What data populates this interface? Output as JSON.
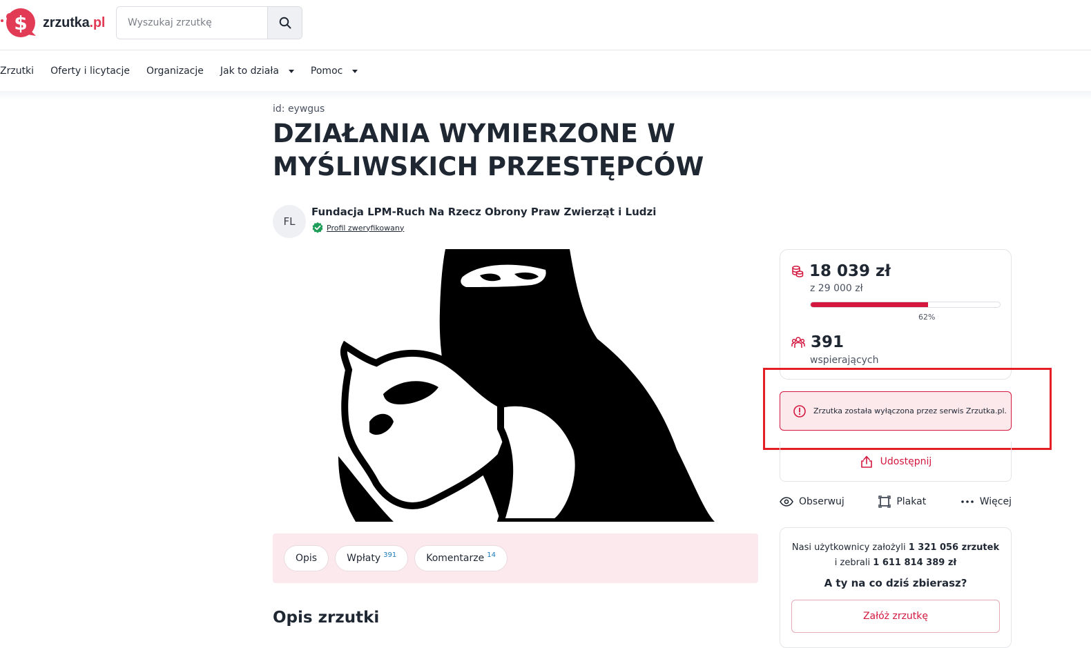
{
  "brand": {
    "name": "zrzutka",
    "tld": ".pl",
    "accent": "#e23b56"
  },
  "search": {
    "placeholder": "Wyszukaj zrzutkę",
    "icon": "search-icon"
  },
  "nav": {
    "items": [
      {
        "label": "Zrzutki"
      },
      {
        "label": "Oferty i licytacje"
      },
      {
        "label": "Organizacje"
      },
      {
        "label": "Jak to działa"
      },
      {
        "label": "Pomoc"
      }
    ]
  },
  "fundraiser": {
    "id_label": "id: eywgus",
    "title": "DZIAŁANIA WYMIERZONE W MYŚLIWSKICH PRZESTĘPCÓW",
    "organizer": {
      "initials": "FL",
      "name": "Fundacja LPM-Ruch Na Rzecz Obrony Praw Zwierząt i Ludzi",
      "verified_label": "Profil zweryfikowany"
    }
  },
  "tabs": [
    {
      "label": "Opis",
      "count": ""
    },
    {
      "label": "Wpłaty",
      "count": "391"
    },
    {
      "label": "Komentarze",
      "count": "14"
    }
  ],
  "description": {
    "heading": "Opis zrzutki"
  },
  "stats": {
    "amount": "18 039 zł",
    "goal": "z 29 000 zł",
    "progress_fraction": 0.62,
    "percent_label": "62%",
    "supporters": "391",
    "supporters_label": "wspierających"
  },
  "alert": {
    "text": "Zrzutka została wyłączona przez serwis Zrzutka.pl."
  },
  "share": {
    "label": "Udostępnij"
  },
  "actions": [
    {
      "label": "Obserwuj",
      "icon": "eye-icon"
    },
    {
      "label": "Plakat",
      "icon": "poster-icon"
    },
    {
      "label": "Więcej",
      "icon": "more-icon"
    }
  ],
  "promo": {
    "prefix": "Nasi użytkownicy założyli",
    "count_fundraisers": "1 321 056 zrzutek",
    "middle": "i zebrali",
    "total_collected": "1 611 814 389 zł",
    "question": "A ty na co dziś zbierasz?",
    "button": "Załóż zrzutkę"
  },
  "colors": {
    "primary": "#d3173e",
    "tab_bar": "#fce9ed",
    "alert_bg": "#fbe9ec",
    "highlight": "#e31e24"
  }
}
